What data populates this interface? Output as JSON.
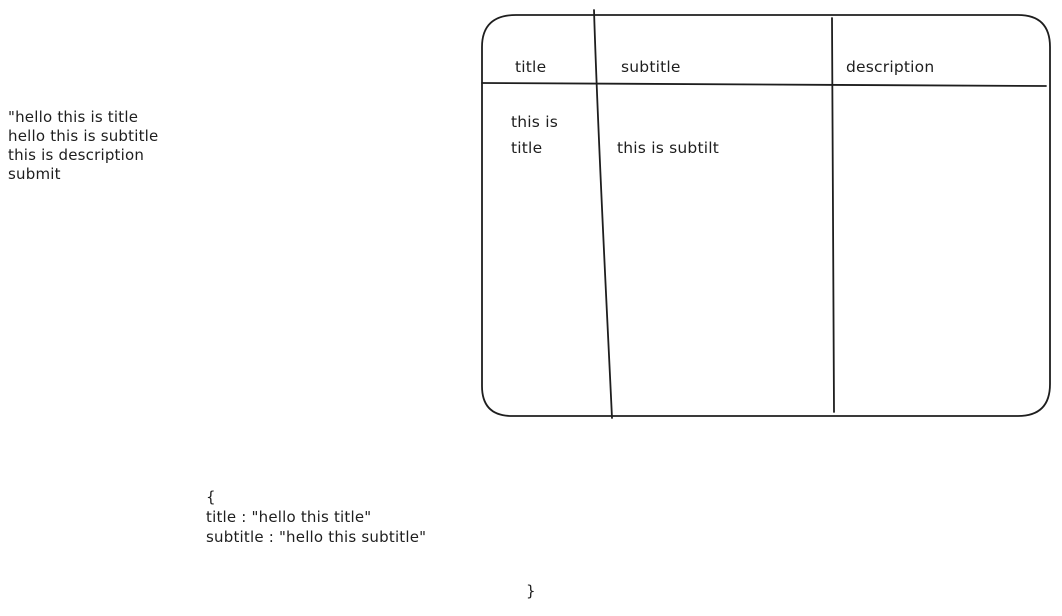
{
  "notes": {
    "lines": [
      "\"hello this is title",
      "hello this is subtitle",
      "this is description",
      "submit"
    ]
  },
  "table": {
    "headers": [
      "title",
      "subtitle",
      "description"
    ],
    "row": {
      "title_line1": "this is",
      "title_line2": "title",
      "subtitle": "this is subtilt",
      "description": ""
    }
  },
  "json_sketch": {
    "open_brace": "{",
    "lines": [
      "title : \"hello this title\"",
      "subtitle : \"hello this subtitle\""
    ],
    "close_brace": "}"
  },
  "colors": {
    "stroke": "#1e1e1e",
    "background": "#ffffff"
  }
}
